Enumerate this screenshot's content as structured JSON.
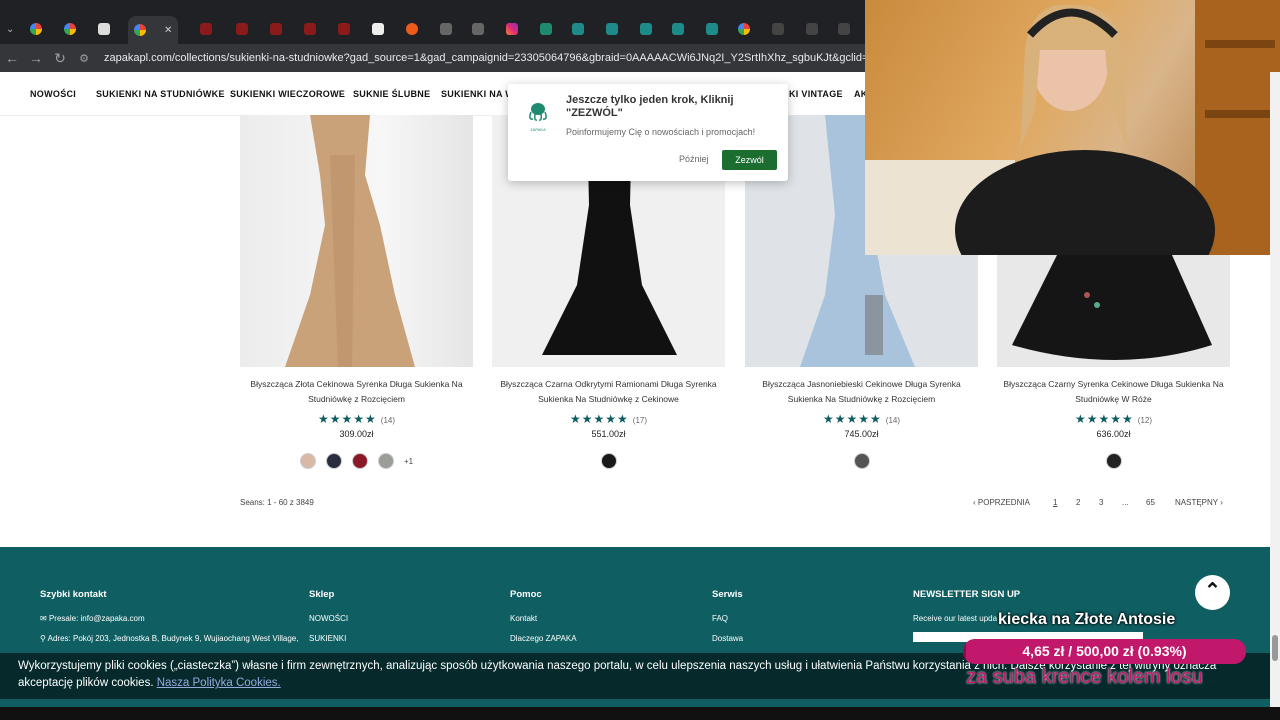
{
  "browser": {
    "url": "zapakapl.com/collections/sukienki-na-studniowke?gad_source=1&gad_campaignid=23305064796&gbraid=0AAAAACWi6JNq2I_Y2SrtIhXhz_sgbuKJt&gclid=Cj0KCQiAyP3KBhD9ARIsAAJ"
  },
  "nav": {
    "items": [
      "NOWOŚCI",
      "SUKIENKI NA STUDNIÓWKE",
      "SUKIENKI WIECZOROWE",
      "SUKNIE ŚLUBNE",
      "SUKIENKI NA WE",
      "KI VINTAGE",
      "AK"
    ]
  },
  "popup": {
    "title": "Jeszcze tylko jeden krok,  Kliknij \"ZEZWÓL\"",
    "body": "Poinformujemy Cię o nowościach i promocjach!",
    "later": "Później",
    "allow": "Zezwól",
    "logo_text": "ZAPAKA"
  },
  "products": [
    {
      "name": "Błyszcząca Złota Cekinowa Syrenka Długa Sukienka Na Studniówkę z Rozcięciem",
      "reviews": "(14)",
      "price": "309.00zł",
      "swatches": [
        "#d9b8a8",
        "#2a2d40",
        "#8a1a2a",
        "#9a9d98"
      ],
      "more": "+1",
      "dress": "#c9a27a"
    },
    {
      "name": "Błyszcząca Czarna Odkrytymi Ramionami Długa Syrenka Sukienka Na Studniówkę z Cekinowe",
      "reviews": "(17)",
      "price": "551.00zł",
      "swatches": [
        "#1a1a1a"
      ],
      "more": "",
      "dress": "#111"
    },
    {
      "name": "Błyszcząca Jasnoniebieski Cekinowe Długa Syrenka Sukienka Na Studniówkę z Rozcięciem",
      "reviews": "(14)",
      "price": "745.00zł",
      "swatches": [
        "#555"
      ],
      "more": "",
      "dress": "#a9c3dd"
    },
    {
      "name": "Błyszcząca Czarny Syrenka Cekinowe Długa Sukienka Na Studniówkę W Róże",
      "reviews": "(12)",
      "price": "636.00zł",
      "swatches": [
        "#222"
      ],
      "more": "",
      "dress": "#151515"
    }
  ],
  "results": "Seans: 1 - 60 z 3849",
  "pagination": {
    "prev": "POPRZEDNIA",
    "pages": [
      "1",
      "2",
      "3",
      "...",
      "65"
    ],
    "next": "NASTĘPNY"
  },
  "footer": {
    "col1": {
      "title": "Szybki kontakt",
      "lines": [
        "Presale: info@zapaka.com",
        "Adres:  Pokój 203, Jednostka B, Budynek 9, Wujiaochang West Village,"
      ]
    },
    "col2": {
      "title": "Sklep",
      "lines": [
        "NOWOŚCI",
        "SUKIENKI"
      ]
    },
    "col3": {
      "title": "Pomoc",
      "lines": [
        "Kontakt",
        "Dlaczego ZAPAKA"
      ]
    },
    "col4": {
      "title": "Serwis",
      "lines": [
        "FAQ",
        "Dostawa"
      ]
    },
    "col5": {
      "title": "NEWSLETTER SIGN UP",
      "lines": [
        "Receive our latest upda"
      ]
    }
  },
  "cookie": {
    "text": "Wykorzystujemy pliki cookies („ciasteczka”) własne i firm zewnętrznych, analizując sposób użytkowania naszego portalu, w celu ulepszenia naszych usług i ułatwienia Państwu korzystania z nich. Dalsze korzystanie z tej witryny oznacza akceptację plików cookies.",
    "link": "Nasza Polityka Cookies."
  },
  "overlay": {
    "goal_title": "kiecka na Złote Antosie",
    "goal_progress": "4,65 zł / 500,00 zł (0.93%)",
    "goal_fraction": 0.0093,
    "scroll_text": "za suba krence kolem losu"
  },
  "colors": {
    "footer": "#0f5e62",
    "star": "#0d5c63",
    "allow": "#1b6e2f",
    "goal_bar": "#c2186b"
  }
}
